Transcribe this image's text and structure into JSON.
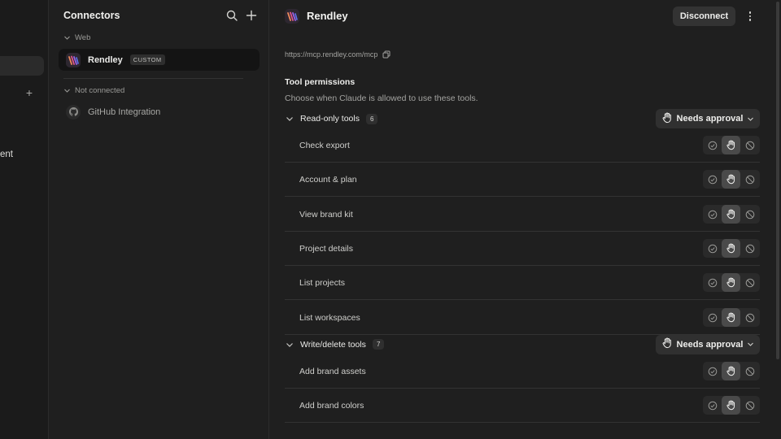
{
  "leftnav": {
    "fragment_text": "ent"
  },
  "connectors": {
    "title": "Connectors",
    "groups": [
      {
        "label": "Web",
        "items": [
          {
            "name": "Rendley",
            "badge": "CUSTOM",
            "active": true
          }
        ]
      },
      {
        "label": "Not connected",
        "items": [
          {
            "name": "GitHub Integration",
            "icon": "github-icon"
          }
        ]
      }
    ]
  },
  "main": {
    "title": "Rendley",
    "disconnect_label": "Disconnect",
    "url": "https://mcp.rendley.com/mcp",
    "permissions_title": "Tool permissions",
    "permissions_subtitle": "Choose when Claude is allowed to use these tools.",
    "groups": [
      {
        "name": "Read-only tools",
        "count": "6",
        "policy": "Needs approval",
        "tools": [
          "Check export",
          "Account & plan",
          "View brand kit",
          "Project details",
          "List projects",
          "List workspaces"
        ]
      },
      {
        "name": "Write/delete tools",
        "count": "7",
        "policy": "Needs approval",
        "tools": [
          "Add brand assets",
          "Add brand colors"
        ]
      }
    ],
    "tool_selected_option": "needs-approval"
  },
  "colors": {
    "background": "#1f1f1f",
    "active_item": "#141414",
    "selected_segment": "#4a4a4a"
  }
}
